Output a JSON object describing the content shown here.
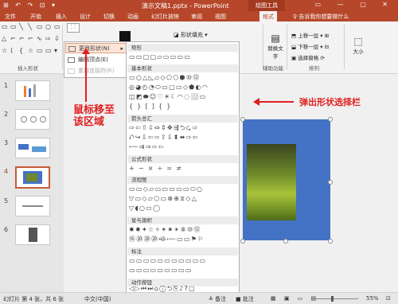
{
  "titlebar": {
    "quick_access": "⊞ ↶ ↷ ⊡ ▾",
    "title": "演示文稿1.pptx - PowerPoint",
    "tool_context": "绘图工具",
    "window_controls": "▭ — ▢ ✕"
  },
  "tabs": [
    "文件",
    "开始",
    "插入",
    "设计",
    "切换",
    "动画",
    "幻灯片放映",
    "审阅",
    "视图",
    "格式"
  ],
  "tell_me": "♀ 告诉我你想要做什么",
  "ribbon": {
    "insert_shapes_label": "插入形状",
    "shape_fill": "形状填充",
    "bring_forward": "上移一层",
    "send_backward": "下移一层",
    "selection_pane": "选择窗格",
    "replace_text": "替换文字",
    "alt_text_label": "辅助功能",
    "arrange_label": "排列",
    "size_label": "大小"
  },
  "menu": {
    "items": [
      {
        "label": "更改形状(N)",
        "state": "highlight"
      },
      {
        "label": "编辑顶点(E)",
        "state": "normal"
      },
      {
        "label": "重排连接符(R)",
        "state": "disabled"
      }
    ]
  },
  "gallery": {
    "sections": [
      {
        "title": "矩形",
        "rows": [
          "▭▭▢▢▱▭▭▭▭"
        ]
      },
      {
        "title": "基本形状",
        "rows": [
          "▭○△◺▱◇⬠⬡⬢⑩⑫",
          "◎◕◴◔⬭▭▢▭◇⬟◐◠",
          "◫◩⬬☺♡☀☾◠◌⬜▭",
          "{ } [ ] { }"
        ]
      },
      {
        "title": "箭头总汇",
        "rows": [
          "⇨⇦⇧⇩⇔⇕✥⇶⮌⮎⇨",
          "⮏↪⇩⇦⇨⇧⇩⬍⬌⇨⇦",
          "⬳⇉⇒⇨⇦"
        ]
      },
      {
        "title": "公式形状",
        "rows": [
          "+ − × ÷ = ≠"
        ]
      },
      {
        "title": "流程图",
        "rows": [
          "▭▭◇▱▭▭▭▭▭⬭○",
          "▽▭◇⏥⬡▭⊗⊕⧖◇△",
          "▽◖○▭◯"
        ]
      },
      {
        "title": "星与旗帜",
        "rows": [
          "✸✹✦☆✧✶✷✴⑧⑩⑫",
          "⑯⑳⑳⑳⬲⬳▭▭⚑⚐"
        ]
      },
      {
        "title": "标注",
        "rows": [
          "▭▭▭▭▭▭▭▭▭▭▭",
          "▭▭▭▭▭▭▭▭▭"
        ]
      },
      {
        "title": "动作按钮",
        "rows": [
          "◁▷⏮⏭⌂ⓘ⮌⎘♪?▢"
        ]
      }
    ]
  },
  "annotations": {
    "left_note": "鼠标移至\n该区域",
    "right_note": "弹出形状选择栏"
  },
  "slides": [
    "1",
    "2",
    "3",
    "4",
    "5",
    "6"
  ],
  "status": {
    "slide_info": "幻灯片 第 4 张，共 6 张",
    "language": "中文(中国)",
    "notes": "≜ 备注",
    "comments": "■ 批注",
    "zoom": "55%"
  },
  "colors": {
    "brand": "#b7472a",
    "accent_red": "#e02020",
    "slide_blue": "#4472c4"
  }
}
